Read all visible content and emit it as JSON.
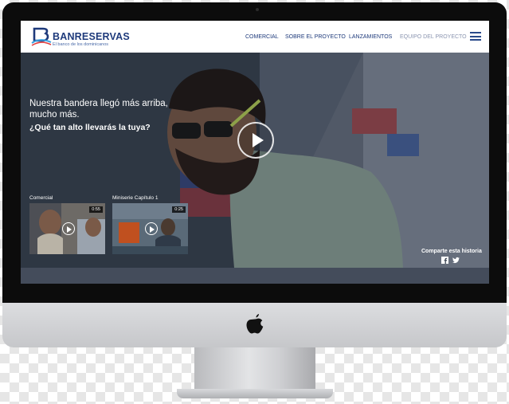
{
  "header": {
    "logo_name": "BANRESERVAS",
    "logo_tagline": "El banco de los dominicanos",
    "nav": [
      {
        "label": "COMERCIAL"
      },
      {
        "label": "SOBRE EL PROYECTO"
      },
      {
        "label": "LANZAMIENTOS"
      },
      {
        "label": "EQUIPO DEL PROYECTO"
      }
    ]
  },
  "hero": {
    "title": "Nuestra bandera llegó más arriba, mucho más.",
    "subtitle": "¿Qué tan alto llevarás la tuya?"
  },
  "videos": [
    {
      "label": "Comercial",
      "duration": "0:55"
    },
    {
      "label": "Miniserie Capítulo 1",
      "duration": "0:25"
    }
  ],
  "share": {
    "label": "Comparte esta historia"
  },
  "icons": {
    "play": "play-icon",
    "menu": "hamburger-icon",
    "facebook": "facebook-icon",
    "twitter": "twitter-icon",
    "apple": "apple-logo-icon"
  },
  "colors": {
    "brand_blue": "#1e3a7b",
    "nav_muted": "#8b95b0",
    "bezel": "#0c0c0c",
    "chin": "#d2d3d6"
  }
}
